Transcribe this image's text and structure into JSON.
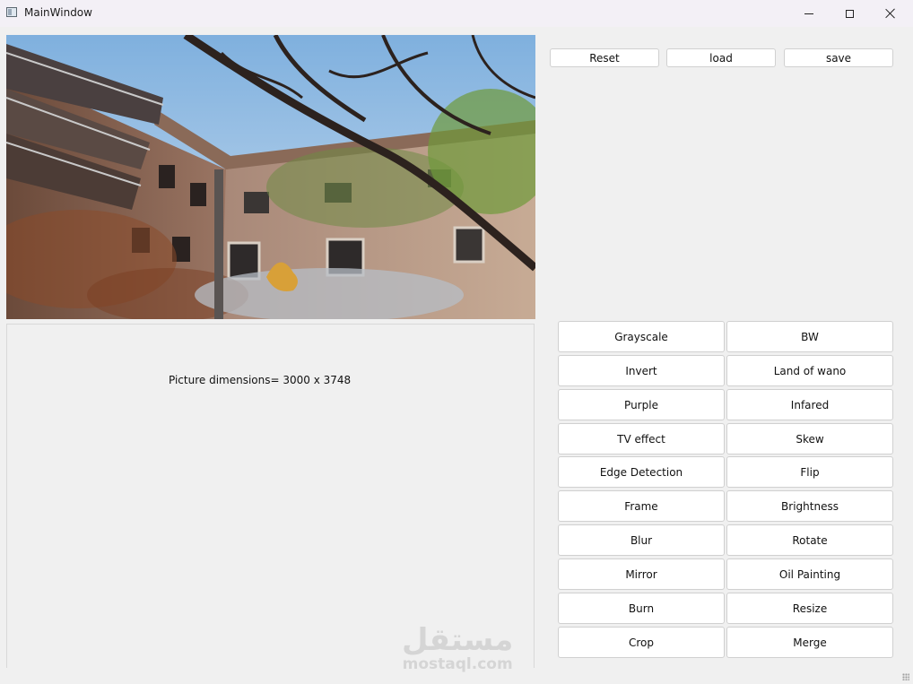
{
  "window": {
    "title": "MainWindow"
  },
  "toolbar": {
    "reset_label": "Reset",
    "load_label": "load",
    "save_label": "save"
  },
  "info": {
    "dimensions_text": "Picture dimensions= 3000 x 3748"
  },
  "filters": [
    {
      "left": "Grayscale",
      "right": "BW"
    },
    {
      "left": "Invert",
      "right": "Land of wano"
    },
    {
      "left": "Purple",
      "right": "Infared"
    },
    {
      "left": "TV effect",
      "right": "Skew"
    },
    {
      "left": "Edge Detection",
      "right": "Flip"
    },
    {
      "left": "Frame",
      "right": "Brightness"
    },
    {
      "left": "Blur",
      "right": "Rotate"
    },
    {
      "left": "Mirror",
      "right": "Oil Painting"
    },
    {
      "left": "Burn",
      "right": "Resize"
    },
    {
      "left": "Crop",
      "right": "Merge"
    }
  ],
  "watermark": {
    "arabic": "مستقل",
    "latin": "mostaql.com"
  },
  "icons": {
    "app": "window-icon",
    "minimize": "minimize-icon",
    "maximize": "maximize-icon",
    "close": "close-icon"
  }
}
